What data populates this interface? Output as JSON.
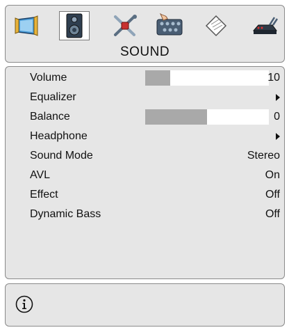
{
  "tabs": [
    {
      "id": "picture",
      "icon": "picture-icon",
      "active": false
    },
    {
      "id": "sound",
      "icon": "speaker-icon",
      "active": true
    },
    {
      "id": "setup",
      "icon": "tools-icon",
      "active": false
    },
    {
      "id": "features",
      "icon": "features-icon",
      "active": false
    },
    {
      "id": "install",
      "icon": "document-icon",
      "active": false
    },
    {
      "id": "source",
      "icon": "network-icon",
      "active": false
    }
  ],
  "menu_title": "SOUND",
  "items": [
    {
      "label": "Volume",
      "value": "10",
      "level": 0.2
    },
    {
      "label": "Equalizer",
      "value": ""
    },
    {
      "label": "Balance",
      "value": "0",
      "level": 0.5
    },
    {
      "label": "Headphone",
      "value": ""
    },
    {
      "label": "Sound Mode",
      "value": "Stereo"
    },
    {
      "label": "AVL",
      "value": "On"
    },
    {
      "label": "Effect",
      "value": "Off"
    },
    {
      "label": "Dynamic Bass",
      "value": "Off"
    }
  ],
  "info_icon": "info-icon",
  "colors": {
    "panel": "#e6e6e6",
    "bar_fill": "#a9a9a9",
    "tab_active": "#ffffff"
  }
}
